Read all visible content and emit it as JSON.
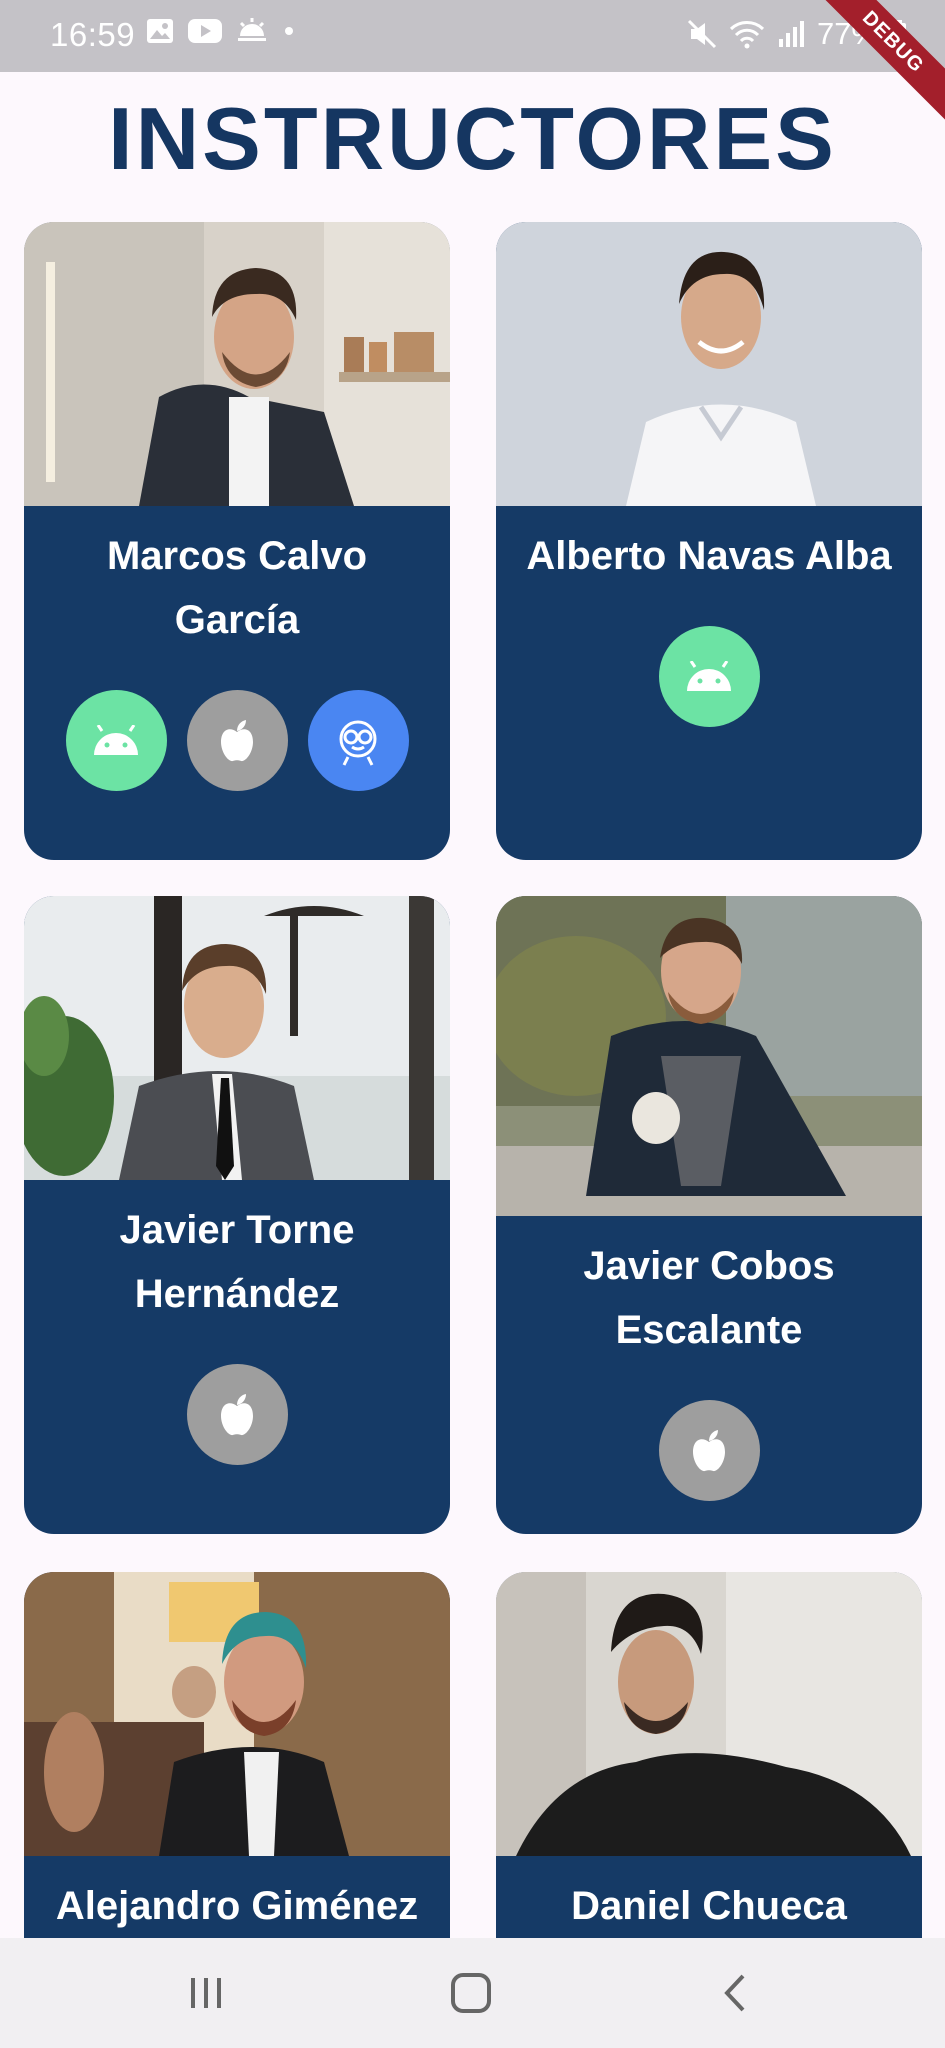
{
  "status_bar": {
    "time": "16:59",
    "battery": "77%",
    "debug_label": "DEBUG"
  },
  "page": {
    "title": "INSTRUCTORES"
  },
  "instructors": [
    {
      "name_line1": "Marcos Calvo",
      "name_line2": "García",
      "platforms": [
        "android",
        "apple",
        "flutter"
      ]
    },
    {
      "name_line1": "Alberto Navas Alba",
      "name_line2": "",
      "platforms": [
        "android"
      ]
    },
    {
      "name_line1": "Javier Torne",
      "name_line2": "Hernández",
      "platforms": [
        "apple"
      ]
    },
    {
      "name_line1": "Javier Cobos",
      "name_line2": "Escalante",
      "platforms": [
        "apple"
      ]
    },
    {
      "name_line1": "Alejandro Giménez",
      "name_line2": "",
      "platforms": []
    },
    {
      "name_line1": "Daniel Chueca",
      "name_line2": "",
      "platforms": []
    }
  ],
  "icons": {
    "android": "android-icon",
    "apple": "apple-icon",
    "flutter": "flutter-icon",
    "recent_apps": "recent-apps-icon",
    "home": "home-icon",
    "back": "back-icon"
  },
  "colors": {
    "card_background": "#153a66",
    "title": "#153661",
    "android": "#6ce3a4",
    "apple": "#9e9e9e",
    "flutter": "#4a86f2"
  }
}
